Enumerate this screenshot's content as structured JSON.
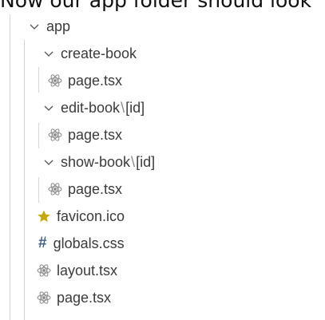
{
  "caption": "Now our app folder should look",
  "tree": {
    "root": {
      "label": "app",
      "expanded": true
    },
    "create_book": {
      "label": "create-book",
      "expanded": true,
      "file": "page.tsx"
    },
    "edit_book": {
      "label": "edit-book",
      "separator": "\\",
      "suffix": "[id]",
      "expanded": true,
      "file": "page.tsx"
    },
    "show_book": {
      "label": "show-book",
      "separator": "\\",
      "suffix": "[id]",
      "expanded": true,
      "file": "page.tsx"
    },
    "files": [
      {
        "label": "favicon.ico",
        "icon": "star-icon"
      },
      {
        "label": "globals.css",
        "icon": "hash-icon",
        "icon_text": "#"
      },
      {
        "label": "layout.tsx",
        "icon": "react-icon"
      },
      {
        "label": "page.tsx",
        "icon": "react-icon"
      }
    ]
  },
  "colors": {
    "text": "#3b3b3b",
    "guide": "#d6d6d6",
    "star": "#c7a800",
    "hash": "#3e5f87",
    "react": "#8a8a8a"
  }
}
